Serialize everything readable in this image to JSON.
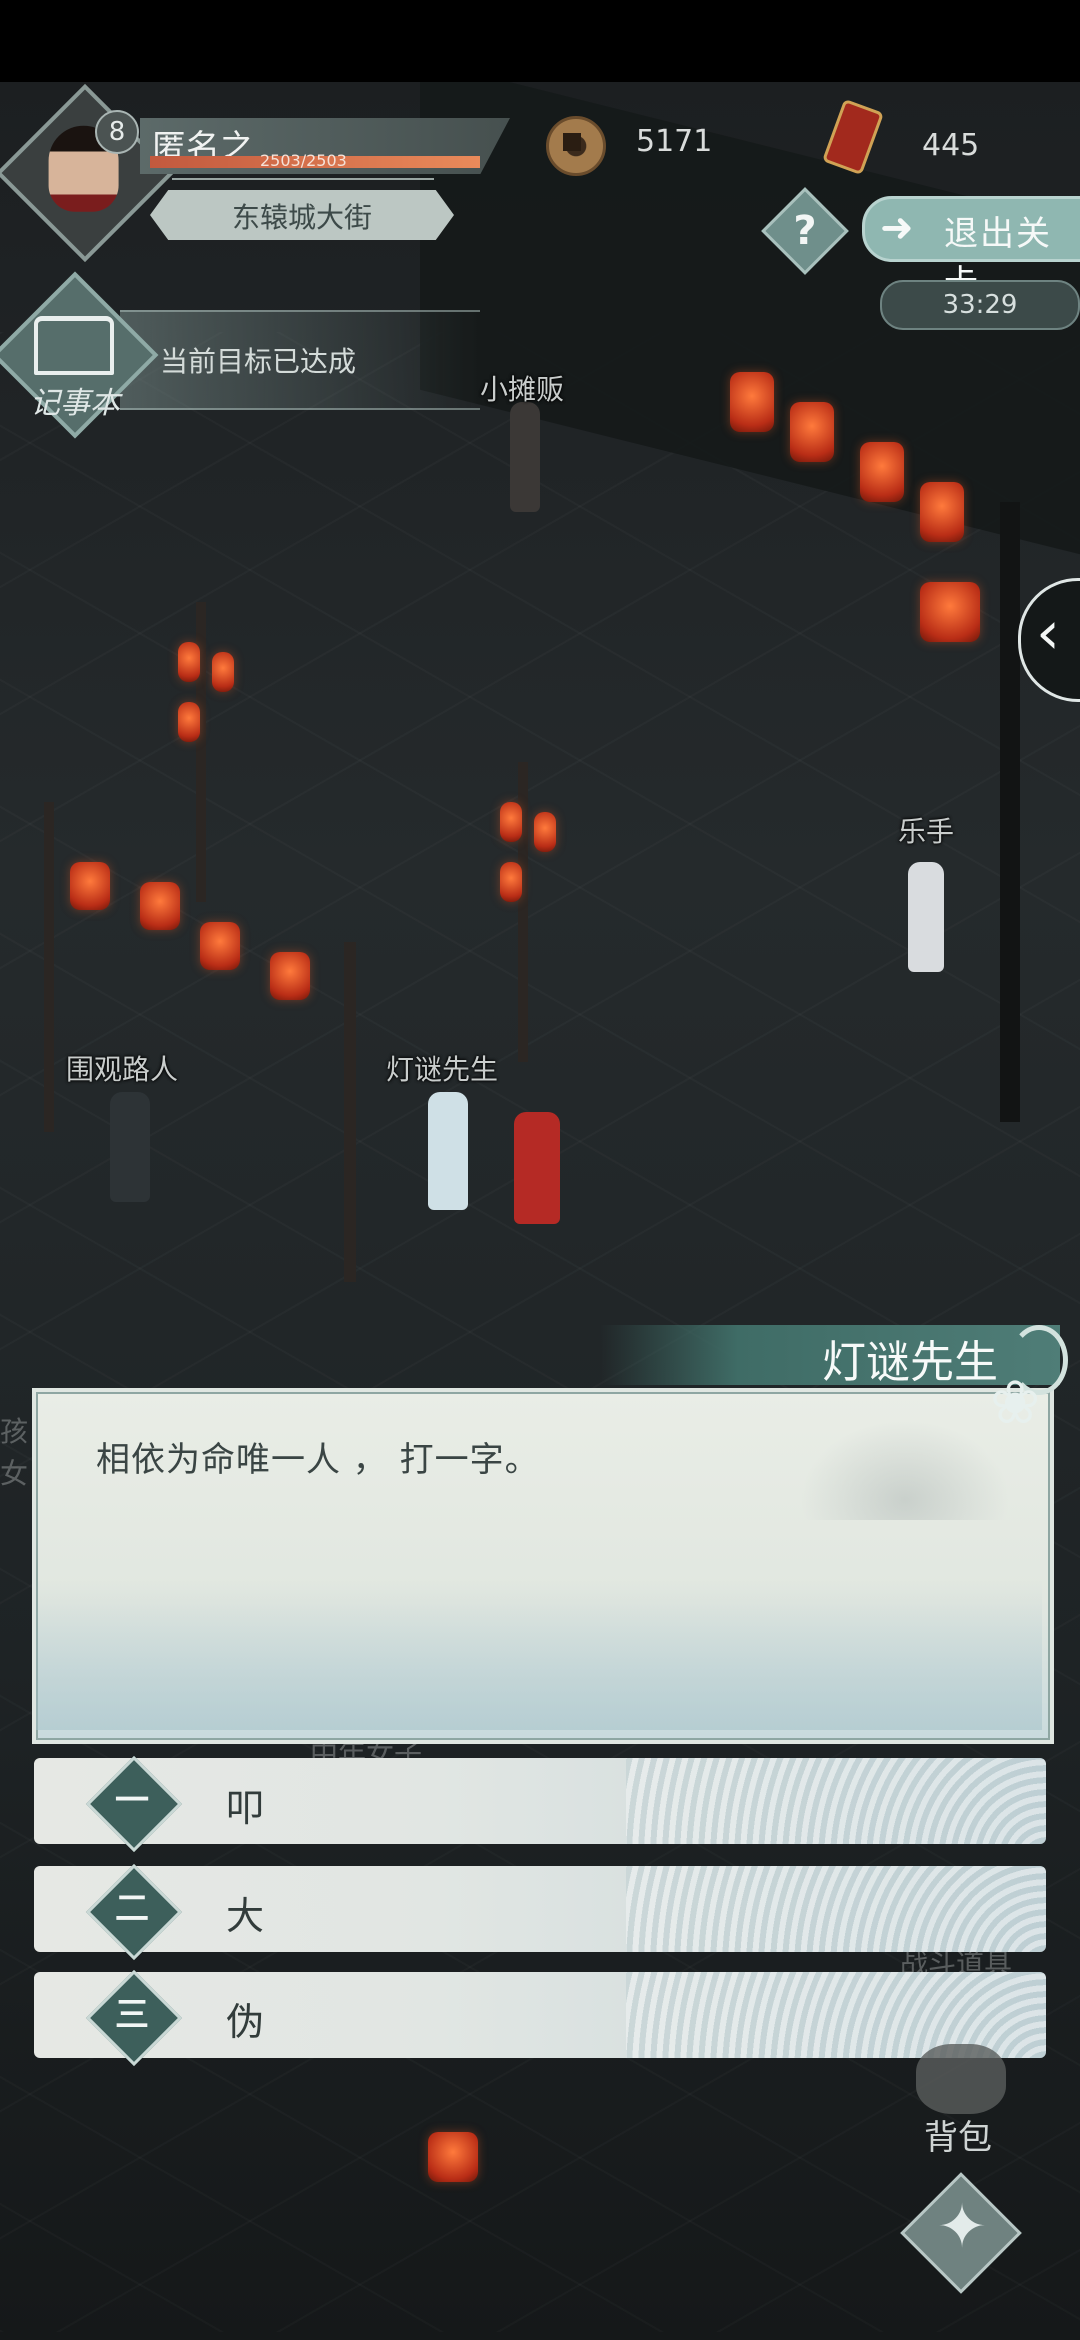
{
  "hud": {
    "level": "8",
    "player_name": "匿名之",
    "hp_text": "2503/2503",
    "location": "东辕城大街",
    "coins": "5171",
    "tokens": "445",
    "exit_label": "退出关卡",
    "timer": "33:29",
    "quest_book_label": "记事本",
    "quest_status": "当前目标已达成"
  },
  "scene": {
    "npc_labels": [
      "小摊贩",
      "乐手",
      "围观路人",
      "灯谜先生"
    ],
    "faded_labels": [
      "中年女子",
      "战斗道具",
      "孩",
      "女"
    ]
  },
  "dialogue": {
    "speaker": "灯谜先生",
    "text": "相依为命唯一人 ， 打一字。",
    "options": [
      {
        "num": "一",
        "text": "叩"
      },
      {
        "num": "二",
        "text": "大"
      },
      {
        "num": "三",
        "text": "伪"
      }
    ]
  },
  "bottom": {
    "bag_label": "背包"
  },
  "icons": [
    "coin-icon",
    "token-icon",
    "help-icon",
    "exit-arrow-icon",
    "book-icon",
    "chevron-left-icon",
    "lotus-icon",
    "bag-icon",
    "skill-star-icon"
  ]
}
